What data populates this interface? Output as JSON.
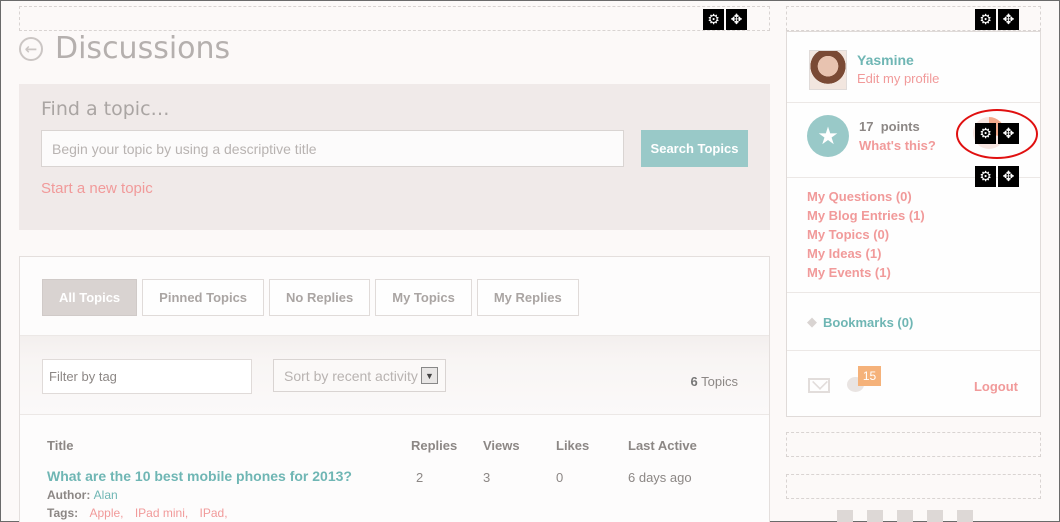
{
  "page": {
    "title": "Discussions"
  },
  "find": {
    "label": "Find a topic…",
    "search_placeholder": "Begin your topic by using a descriptive title",
    "search_button": "Search Topics",
    "new_topic_link": "Start a new topic"
  },
  "tabs": [
    {
      "label": "All Topics",
      "active": true
    },
    {
      "label": "Pinned Topics",
      "active": false
    },
    {
      "label": "No Replies",
      "active": false
    },
    {
      "label": "My Topics",
      "active": false
    },
    {
      "label": "My Replies",
      "active": false
    }
  ],
  "filters": {
    "tag_placeholder": "Filter by tag",
    "sort_value": "Sort by recent activity",
    "count_number": "6",
    "count_label": "Topics"
  },
  "table": {
    "headers": [
      "Title",
      "Replies",
      "Views",
      "Likes",
      "Last Active"
    ],
    "rows": [
      {
        "title": "What are the 10 best mobile phones for 2013?",
        "replies": "2",
        "views": "3",
        "likes": "0",
        "last_active": "6 days ago",
        "author_label": "Author:",
        "author": "Alan",
        "tags_label": "Tags:",
        "tags": [
          "Apple,",
          "IPad mini,",
          "IPad,"
        ]
      }
    ]
  },
  "profile": {
    "name": "Yasmine",
    "edit_link": "Edit my profile",
    "points_value": "17",
    "points_label": "points",
    "whats_this": "What's this?",
    "links": [
      "My Questions (0)",
      "My Blog Entries (1)",
      "My Topics (0)",
      "My Ideas (1)",
      "My Events (1)"
    ],
    "bookmarks": "Bookmarks (0)",
    "notification_count": "15",
    "logout": "Logout"
  },
  "icons": {
    "settings": "gear-icon",
    "move": "move-icon",
    "back": "back-arrow-icon",
    "star": "star-icon",
    "mail": "mail-icon",
    "chat": "chat-icon",
    "bookmark": "bookmark-icon"
  },
  "colors": {
    "accent_teal": "#6fb6b4",
    "accent_pink": "#f19a9a",
    "button_teal": "#99c9c8",
    "badge_orange": "#f5b27a",
    "highlight_red": "#e01010"
  }
}
